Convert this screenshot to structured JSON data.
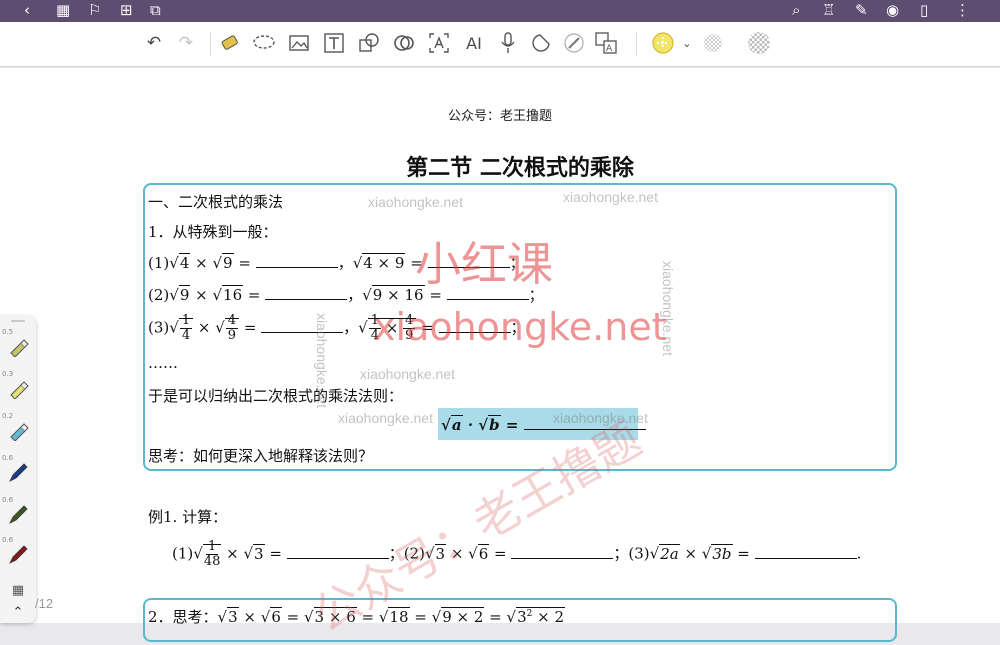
{
  "sysbar": {
    "icons": [
      "back-icon",
      "grid-icon",
      "bookmark-icon",
      "add-page-icon",
      "crop-icon",
      "search-icon",
      "shirt-icon",
      "pen-icon",
      "eye-icon",
      "phone-icon",
      "more-icon"
    ]
  },
  "toolbar": {
    "tools": [
      "undo-icon",
      "redo-icon",
      "highlighter-tool-icon",
      "lasso-icon",
      "image-icon",
      "text-box-icon",
      "shape-icon",
      "ocr-icon",
      "text-recognize-icon",
      "ai-icon",
      "microphone-icon",
      "sticker-icon",
      "laser-icon",
      "translate-icon",
      "color-picker-icon",
      "pattern-icon",
      "pattern2-icon"
    ],
    "ai_label": "AI",
    "accent": "#e6d44a"
  },
  "document": {
    "header_note": "公众号：老王撸题",
    "title": "第二节  二次根式的乘除",
    "section1": "一、二次根式的乘法",
    "item1": "1．从特殊到一般：",
    "q1": {
      "label": "(1)",
      "a": "4",
      "b": "9",
      "c": "4 × 9"
    },
    "q2": {
      "label": "(2)",
      "a": "9",
      "b": "16",
      "c": "9 × 16"
    },
    "q3": {
      "label": "(3)",
      "f1n": "1",
      "f1d": "4",
      "f2n": "4",
      "f2d": "9"
    },
    "ellipsis": "……",
    "rule_intro": "于是可以归纳出二次根式的乘法法则：",
    "rule": {
      "a": "a",
      "dot": "·",
      "b": "b",
      "eq": "="
    },
    "think": "思考：如何更深入地解释该法则？",
    "example_title": "例1. 计算：",
    "ex1": {
      "label": "(1)",
      "fn": "1",
      "fd": "48",
      "b": "3"
    },
    "ex2": {
      "label": "；(2)",
      "a": "3",
      "b": "6"
    },
    "ex3": {
      "label": "；(3)",
      "a": "2a",
      "b": "3b",
      "end": "."
    },
    "item2": "2．思考：",
    "item2_expr": {
      "a": "3",
      "b": "6",
      "c": "3 × 6",
      "d": "18",
      "e": "9 × 2",
      "f": "3",
      "g": "2"
    }
  },
  "watermarks": {
    "gray": [
      "xiaohongke.net",
      "xiaohongke.net",
      "xiaohongke.net",
      "xiaohongke.net",
      "xiaohongke.net",
      "xiaohongke.net",
      "xiaohongke.net"
    ],
    "red_big": "小红课",
    "red_url": "xiaohongke.net",
    "stamp": "公众号：老王撸题"
  },
  "pen_panel": {
    "sizes": [
      "0.5",
      "0.3",
      "0.2",
      "0.6",
      "0.6",
      "0.6"
    ],
    "pen_colors": [
      "#c8c26b",
      "#e4e07a",
      "#62bcd8",
      "#1e3c8c",
      "#3b5a22",
      "#8a1a1a"
    ]
  },
  "page_indicator": "/12"
}
